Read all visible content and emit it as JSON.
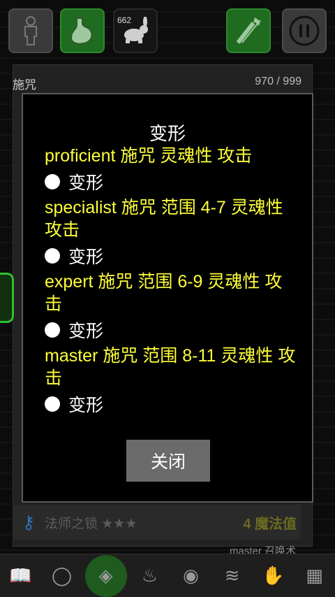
{
  "hud": {
    "speed_count": "662"
  },
  "panel": {
    "title": "施咒",
    "count": "970 / 999"
  },
  "dialog": {
    "title": "变形",
    "entries": [
      {
        "level": "proficient 施咒 灵魂性 攻击",
        "option": "变形"
      },
      {
        "level": "specialist 施咒 范围 4-7 灵魂性 攻击",
        "option": "变形"
      },
      {
        "level": "expert 施咒 范围 6-9 灵魂性 攻击",
        "option": "变形"
      },
      {
        "level": "master 施咒 范围 8-11 灵魂性 攻击",
        "option": "变形"
      }
    ],
    "close_label": "关闭"
  },
  "bottom": {
    "name": "法师之锁 ★★★",
    "value": "4 魔法值",
    "sub": "master 召唤术"
  },
  "icons": {
    "top": [
      "character-icon",
      "stomach-icon",
      "rabbit-icon",
      "quiver-icon",
      "pause-icon"
    ],
    "toolbar": [
      "spellbook-icon",
      "circle-icon",
      "rune-icon",
      "campfire-icon",
      "eye-icon",
      "wave-icon",
      "gloves-icon",
      "map-icon"
    ]
  },
  "colors": {
    "level_text": "#ffff3a",
    "active_green": "#1f6b1f"
  }
}
